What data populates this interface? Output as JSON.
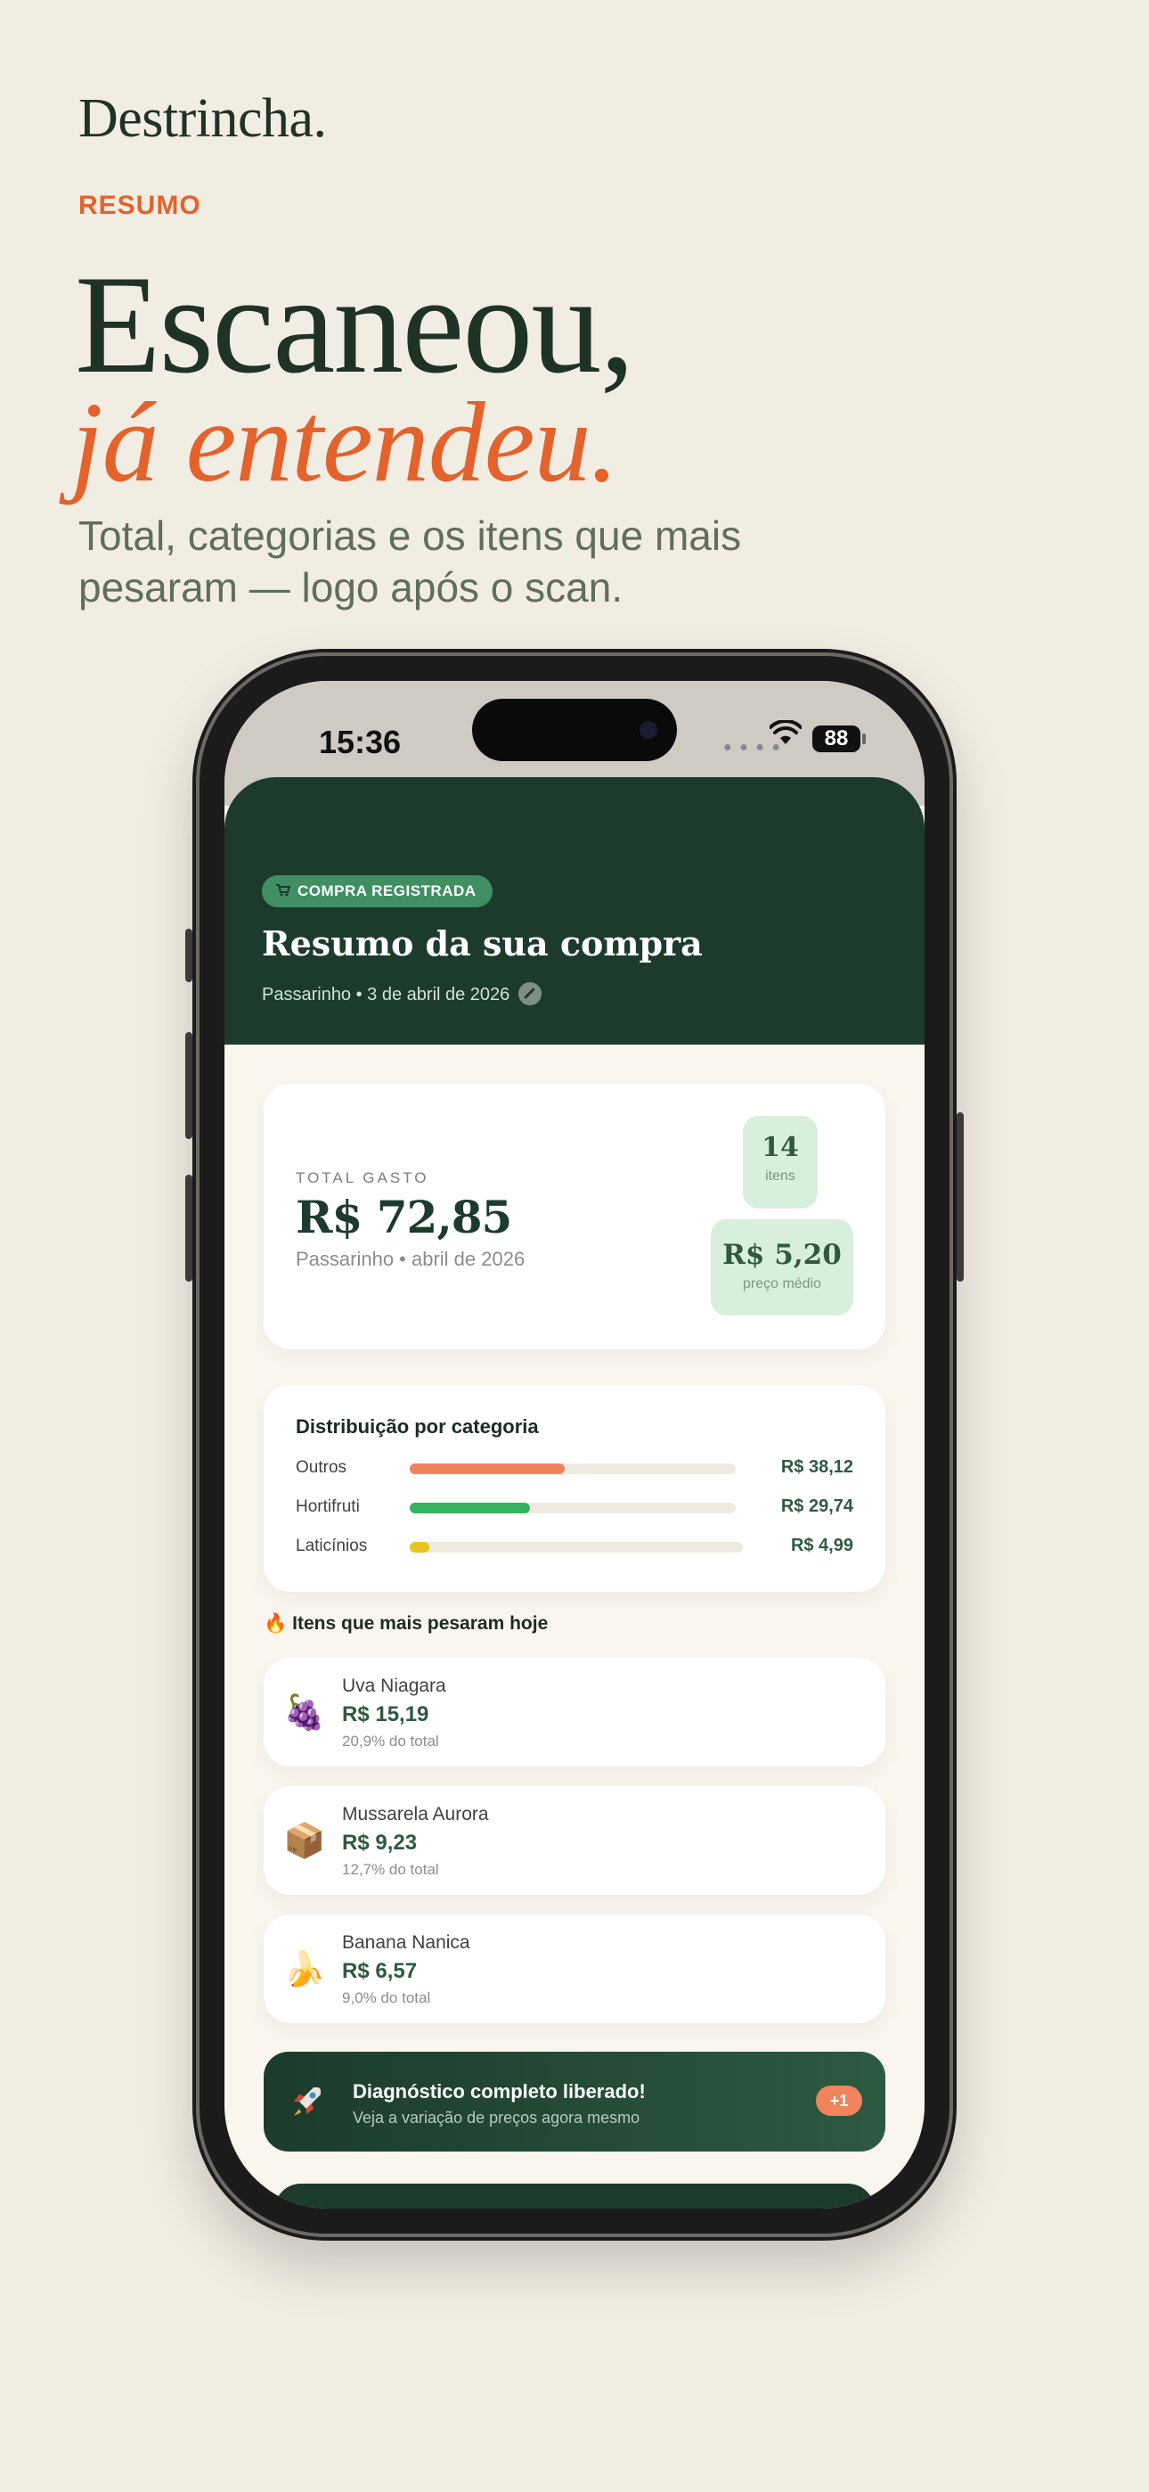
{
  "marketing": {
    "brand": "Destrincha.",
    "eyebrow": "RESUMO",
    "headline_1": "Escaneou,",
    "headline_2": "já entendeu.",
    "subtitle": "Total, categorias e os itens que mais pesaram — logo após o scan."
  },
  "status_bar": {
    "time": "15:36",
    "battery": "88"
  },
  "hero": {
    "badge": "COMPRA REGISTRADA",
    "title": "Resumo da sua compra",
    "meta": "Passarinho • 3 de abril de 2026"
  },
  "total": {
    "label": "TOTAL GASTO",
    "value": "R$ 72,85",
    "sub": "Passarinho • abril de 2026",
    "items_count": "14",
    "items_label": "itens",
    "avg_price": "R$ 5,20",
    "avg_label": "preço médio"
  },
  "distribution": {
    "title": "Distribuição por categoria",
    "rows": [
      {
        "name": "Outros",
        "value": "R$ 38,12",
        "share": 0.475,
        "color": "#ef845c"
      },
      {
        "name": "Hortifruti",
        "value": "R$ 29,74",
        "share": 0.37,
        "color": "#34b25f"
      },
      {
        "name": "Laticínios",
        "value": "R$ 4,99",
        "share": 0.06,
        "color": "#e8c41c"
      }
    ]
  },
  "top_items": {
    "title": "Itens que mais pesaram hoje",
    "items": [
      {
        "name": "Uva Niagara",
        "price": "R$ 15,19",
        "share": "20,9% do total",
        "icon": "grapes-icon",
        "emoji": "🍇"
      },
      {
        "name": "Mussarela Aurora",
        "price": "R$ 9,23",
        "share": "12,7% do total",
        "icon": "package-icon",
        "emoji": "📦"
      },
      {
        "name": "Banana Nanica",
        "price": "R$ 6,57",
        "share": "9,0% do total",
        "icon": "banana-icon",
        "emoji": "🍌"
      }
    ]
  },
  "cta": {
    "title": "Diagnóstico completo liberado!",
    "subtitle": "Veja a variação de preços agora mesmo",
    "pill": "+1"
  }
}
